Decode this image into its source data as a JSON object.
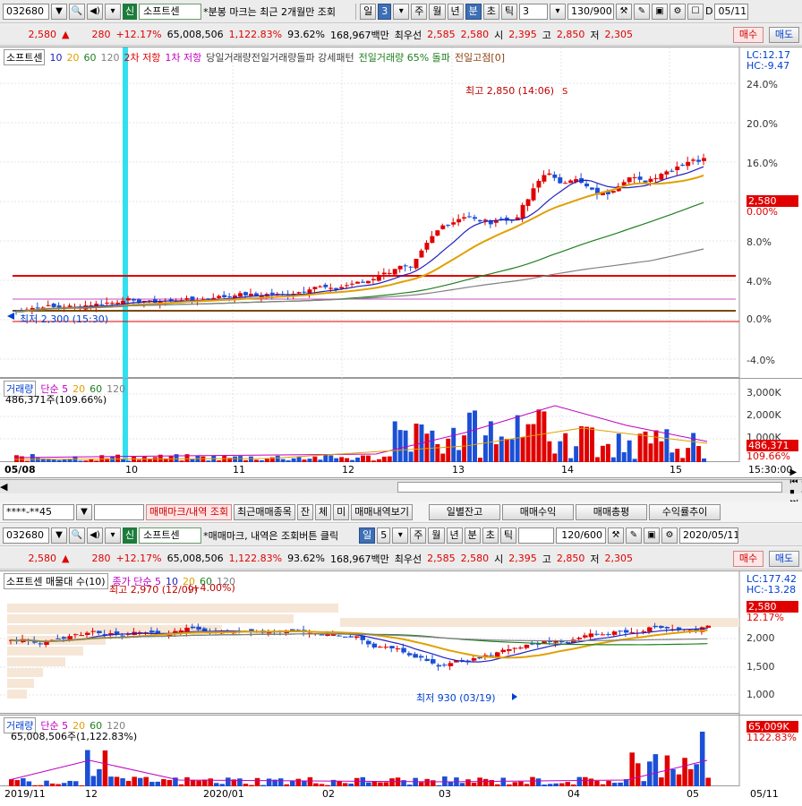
{
  "top": {
    "code": "032680",
    "name_badge": "신",
    "name": "소프트센",
    "notice": "*분봉 마크는 최근 2개월만 조회",
    "periods": [
      "일",
      "3",
      "주",
      "월",
      "년",
      "분",
      "초",
      "틱"
    ],
    "selected_period": "분",
    "interval": "3",
    "count": "130/900",
    "date": "05/11"
  },
  "quote": {
    "price": "2,580",
    "arrow": "▲",
    "change": "280",
    "rate": "+12.17%",
    "volume": "65,008,506",
    "vol_rate": "1,122.83%",
    "rate2": "93.62%",
    "amount": "168,967백만",
    "best_label": "최우선",
    "ask": "2,585",
    "bid": "2,580",
    "open_label": "시",
    "open": "2,395",
    "high_label": "고",
    "high": "2,850",
    "low_label": "저",
    "low": "2,305",
    "buy": "매수",
    "sell": "매도"
  },
  "chart1": {
    "legend": {
      "name": "소프트센",
      "ma": [
        "10",
        "20",
        "60",
        "120"
      ],
      "res2": "2차 저항",
      "res1": "1차 저항",
      "tail": "당일거래량전일거래량돌파 강세패턴",
      "prevvol": "전일거래량 65% 돌파",
      "prevhigh": "전일고점[0]"
    },
    "lc": "LC:12.17",
    "hc": "HC:-9.47",
    "yticks": [
      "24.0%",
      "20.0%",
      "16.0%",
      "12.0%",
      "8.0%",
      "4.0%",
      "0.0%",
      "-4.0%"
    ],
    "price_tag": "2,580",
    "pct_tag": "0.00%",
    "high_note": "최고 2,850 (14:06)",
    "low_note": "최저 2,300 (15:30)",
    "sell_marks": [
      "S",
      "B",
      "S",
      "B"
    ]
  },
  "vol1": {
    "legend": [
      "거래량",
      "단순 5",
      "20",
      "60",
      "120"
    ],
    "value": "486,371주(109.66%)",
    "yticks": [
      "3,000K",
      "2,000K",
      "1,000K"
    ],
    "tag": "486,371",
    "tag2": "109.66%"
  },
  "xaxis1": {
    "labels": [
      "05/08",
      "10",
      "11",
      "12",
      "13",
      "14",
      "15"
    ],
    "time": "15:30:00"
  },
  "mid": {
    "account": "****-**45",
    "buttons": [
      "매매마크/내역 조회",
      "최근매매종목",
      "잔",
      "체",
      "미",
      "매매내역보기"
    ],
    "right_buttons": [
      "일별잔고",
      "매매수익",
      "매매총평",
      "수익률추이"
    ]
  },
  "bottom": {
    "code": "032680",
    "name_badge": "신",
    "name": "소프트센",
    "notice": "*매매마크, 내역은 조회버튼 클릭",
    "periods": [
      "일",
      "5",
      "주",
      "월",
      "년",
      "분",
      "초",
      "틱"
    ],
    "selected_period": "일",
    "count": "120/600",
    "date": "2020/05/11"
  },
  "chart2": {
    "legend": {
      "name": "소프트센 매물대 수(10)",
      "extra": "종가 단순 5",
      "ma": [
        "10",
        "20",
        "60",
        "120"
      ]
    },
    "lc": "LC:177.42",
    "hc": "HC:-13.28",
    "yticks": [
      "2,000",
      "1,500",
      "1,000"
    ],
    "price_tag": "2,580",
    "pct_tag": "12.17%",
    "high_note": "최고 2,970 (12/09)",
    "pct_note": "(+4.00%)",
    "low_note": "최저 930 (03/19)"
  },
  "vol2": {
    "legend": [
      "거래량",
      "단순 5",
      "20",
      "60",
      "120"
    ],
    "value": "65,008,506주(1,122.83%)",
    "tag": "65,009K",
    "tag2": "1122.83%"
  },
  "xaxis2": {
    "labels": [
      "2019/11",
      "12",
      "2020/01",
      "02",
      "03",
      "04",
      "05"
    ],
    "end": "05/11"
  },
  "colors": {
    "up": "#e00000",
    "down": "#1a4fd6",
    "ma10": "#2020c0",
    "ma20": "#e0a000",
    "ma60": "#208020",
    "ma120": "#808080"
  }
}
